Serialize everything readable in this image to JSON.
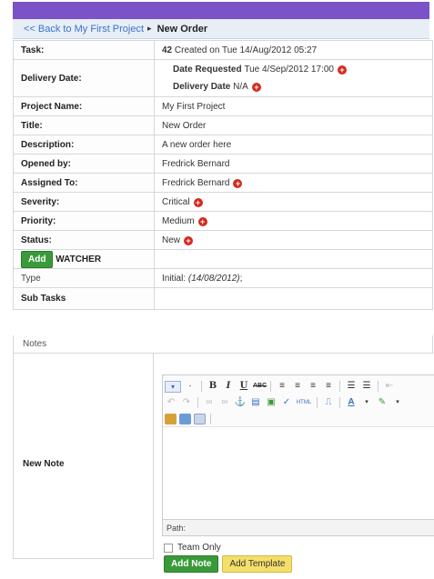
{
  "breadcrumb": {
    "back": "<< Back to My First Project",
    "separator": "▸",
    "current": "New Order"
  },
  "task": {
    "label": "Task:",
    "number": "42",
    "created": "Created on Tue 14/Aug/2012 05:27"
  },
  "delivery": {
    "label": "Delivery Date:",
    "requested_label": "Date Requested",
    "requested_value": "Tue 4/Sep/2012 17:00",
    "date_label": "Delivery Date",
    "date_value": "N/A"
  },
  "fields": {
    "project_label": "Project Name:",
    "project_value": "My First Project",
    "title_label": "Title:",
    "title_value": "New Order",
    "description_label": "Description:",
    "description_value": "A new order here",
    "opened_label": "Opened by:",
    "opened_value": "Fredrick Bernard",
    "assigned_label": "Assigned To:",
    "assigned_value": "Fredrick Bernard",
    "severity_label": "Severity:",
    "severity_value": "Critical",
    "priority_label": "Priority:",
    "priority_value": "Medium",
    "status_label": "Status:",
    "status_value": "New"
  },
  "watcher": {
    "add_label": "Add",
    "label": "WATCHER"
  },
  "type": {
    "label": "Type",
    "prefix": "Initial: ",
    "date": "(14/08/2012)",
    "suffix": ";"
  },
  "subtasks": {
    "label": "Sub Tasks"
  },
  "notes": {
    "label": "Notes",
    "new_note_label": "New Note"
  },
  "editor": {
    "path_label": "Path:",
    "html_button": "HTML"
  },
  "team_only": {
    "label": "Team Only"
  },
  "buttons": {
    "add_note": "Add Note",
    "add_template": "Add Template"
  },
  "colors": {
    "topbar": "#7b52c7",
    "link": "#3b72c8",
    "plus": "#d42a1f",
    "add_green": "#3a9a3a",
    "template_yellow": "#f5df6b",
    "opened_by": "#8b2a2a"
  }
}
